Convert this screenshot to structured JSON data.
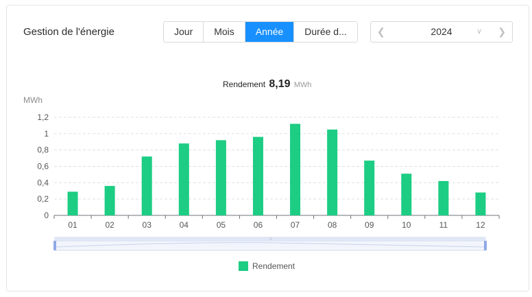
{
  "panel": {
    "title": "Gestion de l'énergie"
  },
  "period_tabs": [
    {
      "label": "Jour",
      "active": false
    },
    {
      "label": "Mois",
      "active": false
    },
    {
      "label": "Année",
      "active": true
    },
    {
      "label": "Durée d...",
      "active": false
    }
  ],
  "year_picker": {
    "value": "2024",
    "prev_icon": "chevron-left-icon",
    "next_icon": "chevron-right-icon",
    "dropdown_icon": "chevron-down-icon"
  },
  "summary": {
    "label": "Rendement",
    "value": "8,19",
    "unit": "MWh"
  },
  "colors": {
    "accent": "#1890ff",
    "bar": "#1ccd83",
    "grid": "#e0e0e0"
  },
  "chart_data": {
    "type": "bar",
    "ylabel": "MWh",
    "xlabel": "",
    "categories": [
      "01",
      "02",
      "03",
      "04",
      "05",
      "06",
      "07",
      "08",
      "09",
      "10",
      "11",
      "12"
    ],
    "series": [
      {
        "name": "Rendement",
        "values": [
          0.29,
          0.36,
          0.72,
          0.88,
          0.92,
          0.96,
          1.12,
          1.05,
          0.67,
          0.51,
          0.42,
          0.28
        ]
      }
    ],
    "ylim": [
      0,
      1.2
    ],
    "yticks": [
      "0",
      "0,2",
      "0,4",
      "0,6",
      "0,8",
      "1",
      "1,2"
    ],
    "grid": true,
    "legend_position": "bottom-center"
  }
}
